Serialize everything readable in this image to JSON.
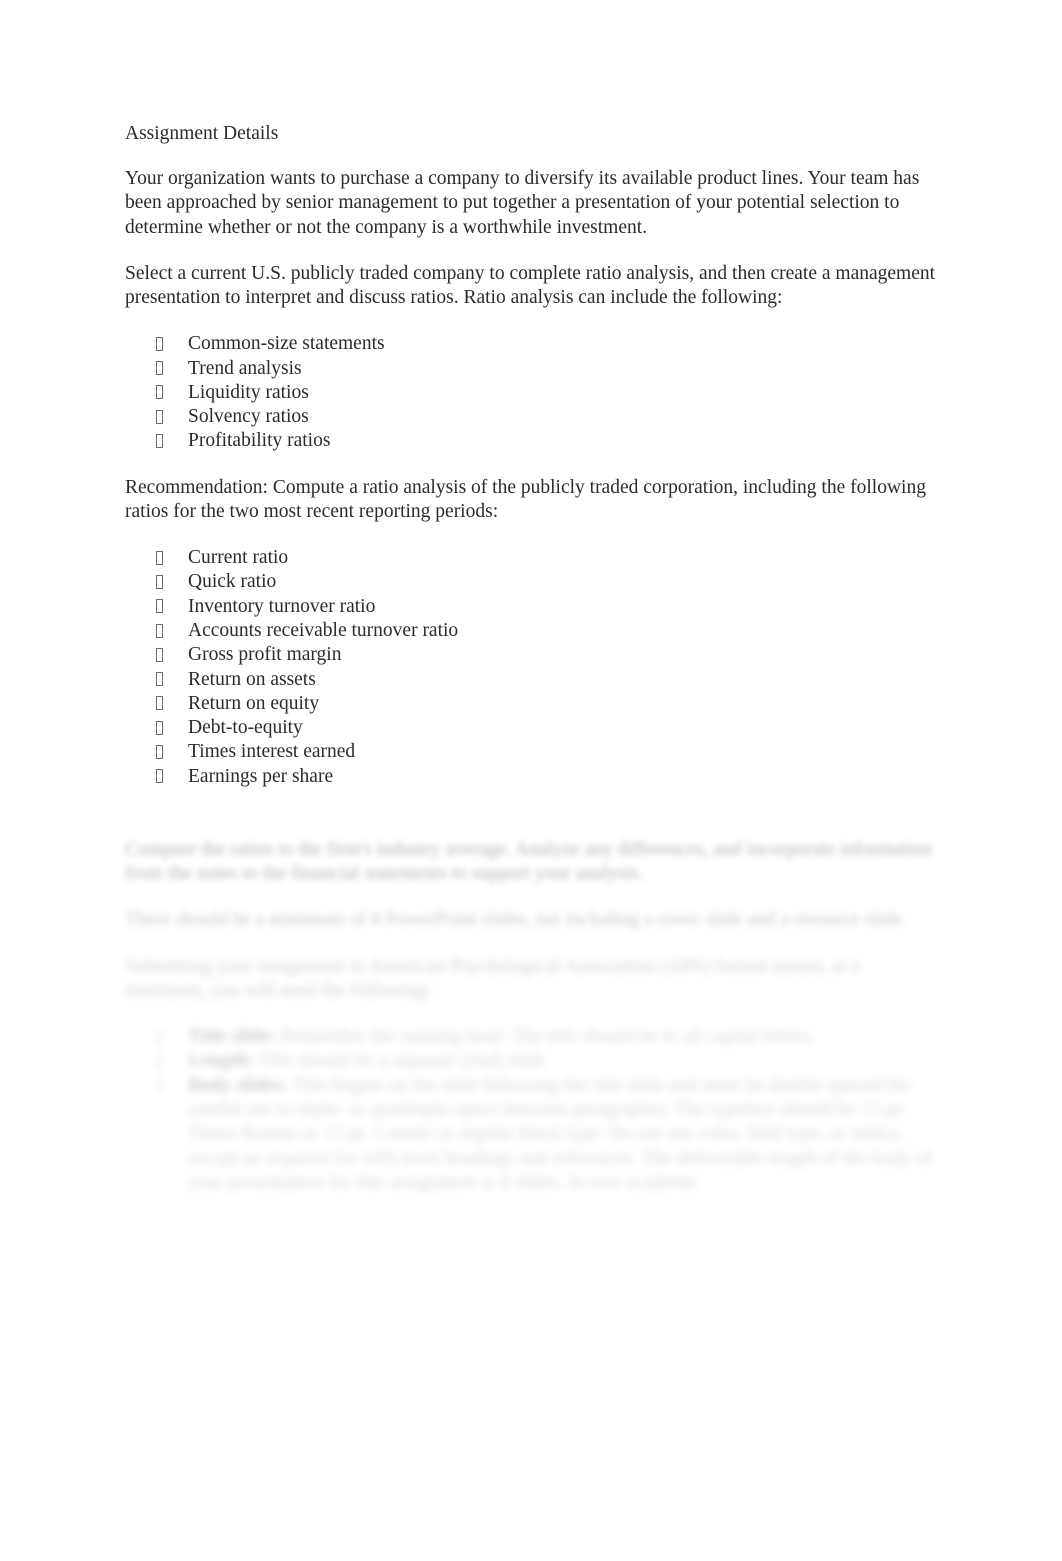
{
  "document": {
    "title": "Assignment Details",
    "paragraphs": {
      "intro": "Your organization wants to purchase a company to diversify its available product lines. Your team has been approached by senior management to put together a presentation of your potential selection to determine whether or not the company is a worthwhile investment.",
      "select": "Select a current U.S. publicly traded company to complete ratio analysis, and then create a management presentation to interpret and discuss ratios. Ratio analysis can include the following:",
      "recommendation": "Recommendation:   Compute a ratio analysis of the publicly traded corporation, including the following ratios for the two most recent reporting periods:"
    },
    "analysis_types": [
      "Common-size statements",
      "Trend analysis",
      "Liquidity ratios",
      "Solvency ratios",
      "Profitability ratios"
    ],
    "ratios": [
      "Current ratio",
      "Quick ratio",
      "Inventory turnover ratio",
      "Accounts receivable turnover ratio",
      "Gross profit margin",
      "Return on assets",
      "Return on equity",
      "Debt-to-equity",
      "Times interest earned",
      "Earnings per share"
    ],
    "faded": {
      "compare": "Compare the ratios to the firm's industry average. Analyze any differences, and incorporate information from the notes to the financial statements to support your analysis.",
      "slides": "There should be a minimum of 8 PowerPoint slides, not including a cover slide and a resource slide.",
      "apa": "Submitting your assignment in American Psychological Association (APA) format means, at a minimum, you will need the following:",
      "items": [
        {
          "lead": "Title slide:",
          "text": " Remember the running head. The title should be in all capital letters."
        },
        {
          "lead": "Length:",
          "text": " This should be a separate (2nd) slide."
        },
        {
          "lead": "Body slides:",
          "text": " This begins on the slide following the title slide and must be double-spaced (be careful not to triple- or quadruple-space between paragraphs). The typeface should be 12-pt. Times Roman or 12-pt. Courier in regular black type. Do not use color, bold type, or italics, except as required for APA level headings and references. The deliverable length of the body of your presentation for this assignment is 8 slides. In-text academic"
        }
      ]
    }
  }
}
